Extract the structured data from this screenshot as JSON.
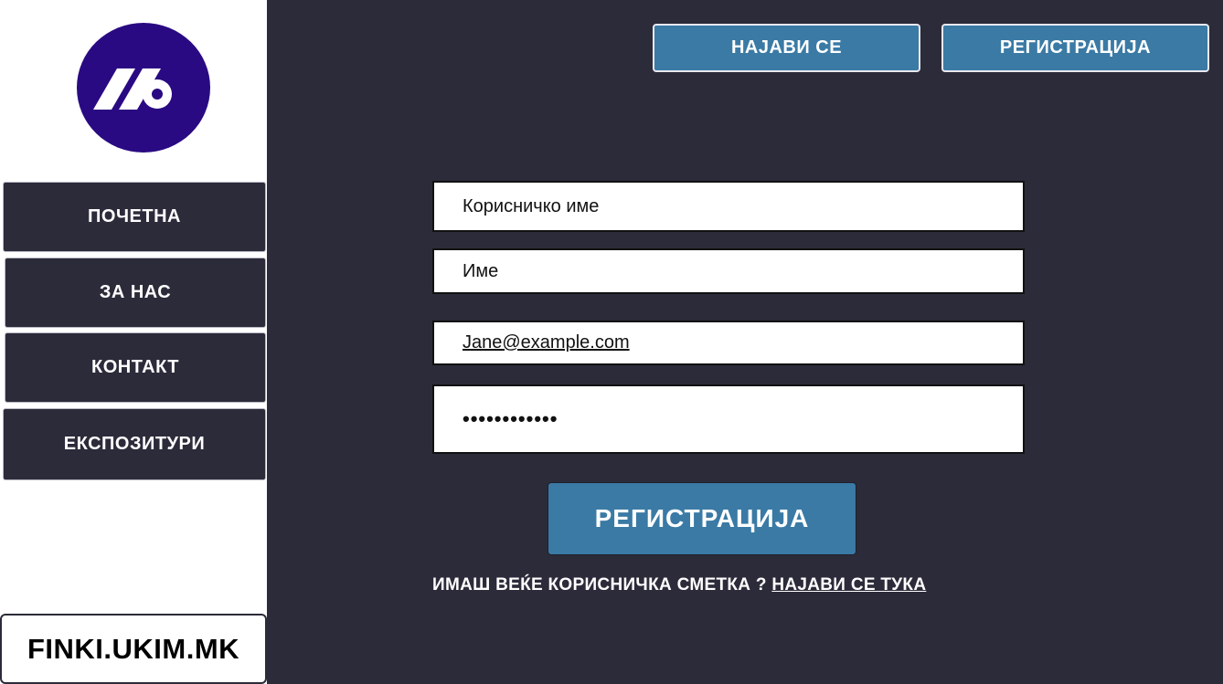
{
  "sidebar": {
    "nav_items": [
      {
        "label": "ПОЧЕТНА"
      },
      {
        "label": "ЗА НАС"
      },
      {
        "label": "КОНТАКТ"
      },
      {
        "label": "ЕКСПОЗИТУРИ"
      }
    ],
    "site_label": "FINKI.UKIM.MK"
  },
  "header": {
    "login_label": "НАЈАВИ СЕ",
    "register_label": "РЕГИСТРАЦИЈА"
  },
  "form": {
    "username_placeholder": "Корисничко име",
    "name_placeholder": "Име",
    "email_value": "Jane@example.com",
    "password_value": "••••••••••••",
    "submit_label": "РЕГИСТРАЦИЈА",
    "footer_prompt": "ИМАШ ВЕЌЕ КОРИСНИЧКА СМЕТКА ?",
    "footer_link": "НАЈАВИ СЕ ТУКА"
  },
  "colors": {
    "background": "#2c2b3a",
    "accent": "#3a7aa5",
    "logo": "#2a0a82"
  },
  "icons": {
    "logo": "brand-logo-icon"
  }
}
